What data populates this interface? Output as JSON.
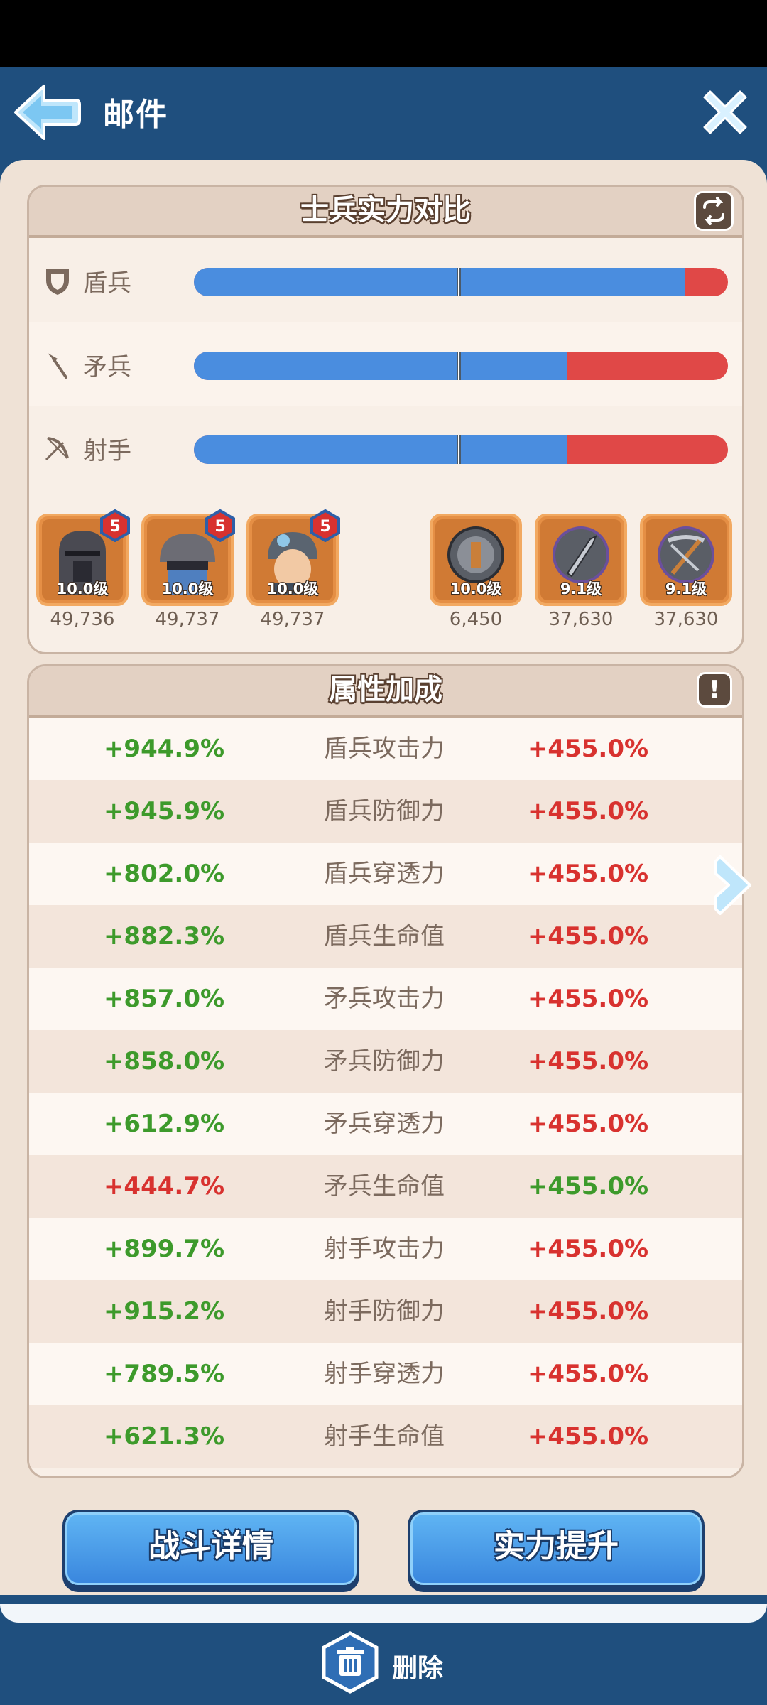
{
  "header": {
    "title": "邮件"
  },
  "comparison": {
    "title": "士兵实力对比",
    "rows": [
      {
        "label": "盾兵",
        "own_share": 0.92
      },
      {
        "label": "矛兵",
        "own_share": 0.7
      },
      {
        "label": "射手",
        "own_share": 0.7
      }
    ],
    "own_units": [
      {
        "level": "10.0级",
        "power": "49,736",
        "badge": "5"
      },
      {
        "level": "10.0级",
        "power": "49,737",
        "badge": "5"
      },
      {
        "level": "10.0级",
        "power": "49,737",
        "badge": "5"
      }
    ],
    "enemy_units": [
      {
        "level": "10.0级",
        "power": "6,450"
      },
      {
        "level": "9.1级",
        "power": "37,630"
      },
      {
        "level": "9.1级",
        "power": "37,630"
      }
    ]
  },
  "attributes": {
    "title": "属性加成",
    "info_label": "!",
    "rows": [
      {
        "left": "+944.9%",
        "name": "盾兵攻击力",
        "right": "+455.0%"
      },
      {
        "left": "+945.9%",
        "name": "盾兵防御力",
        "right": "+455.0%"
      },
      {
        "left": "+802.0%",
        "name": "盾兵穿透力",
        "right": "+455.0%"
      },
      {
        "left": "+882.3%",
        "name": "盾兵生命值",
        "right": "+455.0%"
      },
      {
        "left": "+857.0%",
        "name": "矛兵攻击力",
        "right": "+455.0%"
      },
      {
        "left": "+858.0%",
        "name": "矛兵防御力",
        "right": "+455.0%"
      },
      {
        "left": "+612.9%",
        "name": "矛兵穿透力",
        "right": "+455.0%"
      },
      {
        "left": "+444.7%",
        "name": "矛兵生命值",
        "right": "+455.0%"
      },
      {
        "left": "+899.7%",
        "name": "射手攻击力",
        "right": "+455.0%"
      },
      {
        "left": "+915.2%",
        "name": "射手防御力",
        "right": "+455.0%"
      },
      {
        "left": "+789.5%",
        "name": "射手穿透力",
        "right": "+455.0%"
      },
      {
        "left": "+621.3%",
        "name": "射手生命值",
        "right": "+455.0%"
      }
    ]
  },
  "buttons": {
    "battle_details": "战斗详情",
    "power_up": "实力提升",
    "delete": "删除"
  },
  "colors": {
    "header_blue": "#1f4f7e",
    "own_bar": "#4a8ddf",
    "enemy_bar": "#e04847",
    "positive": "#3d9a2b",
    "negative": "#d8322f"
  }
}
